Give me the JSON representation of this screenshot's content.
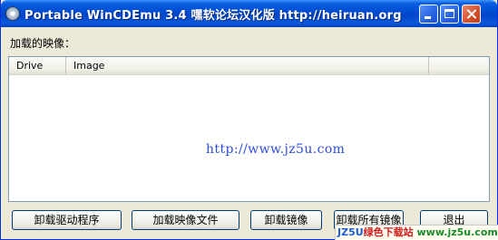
{
  "window": {
    "title": "Portable WinCDEmu 3.4 嘿软论坛汉化版 http://heiruan.org",
    "icon": "cd-drive-icon",
    "controls": [
      "minimize-icon",
      "maximize-icon",
      "close-icon"
    ]
  },
  "main": {
    "mounted_label": "加载的映像：",
    "list": {
      "columns": [
        "Drive",
        "Image",
        ""
      ],
      "rows": []
    },
    "watermark_url": "http://www.jz5u.com"
  },
  "buttons": {
    "unload_driver": "卸载驱动程序",
    "mount_file": "加载映像文件",
    "unmount": "卸载镜像",
    "unmount_all": "卸载所有镜像",
    "exit": "退出"
  },
  "banner": {
    "part1": "JZ5U",
    "part2": "绿色下载站",
    "part3": "www.jz5u.com"
  },
  "colors": {
    "titlebar": "#0054e3",
    "window_bg": "#ece9d8",
    "watermark": "#2e4fd9"
  }
}
